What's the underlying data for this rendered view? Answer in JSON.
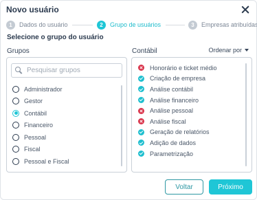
{
  "dialog": {
    "title": "Novo usuário",
    "close_icon": "close-icon"
  },
  "stepper": {
    "steps": [
      {
        "number": "1",
        "label": "Dados do usuário",
        "active": false
      },
      {
        "number": "2",
        "label": "Grupo de usuários",
        "active": true
      },
      {
        "number": "3",
        "label": "Empresas atribuídas",
        "active": false
      }
    ]
  },
  "section_title": "Selecione o grupo do usuário",
  "groups": {
    "label": "Grupos",
    "search": {
      "placeholder": "Pesquisar grupos",
      "value": "",
      "icon": "search-icon"
    },
    "items": [
      {
        "label": "Administrador",
        "selected": false
      },
      {
        "label": "Gestor",
        "selected": false
      },
      {
        "label": "Contábil",
        "selected": true
      },
      {
        "label": "Financeiro",
        "selected": false
      },
      {
        "label": "Pessoal",
        "selected": false
      },
      {
        "label": "Fiscal",
        "selected": false
      },
      {
        "label": "Pessoal e Fiscal",
        "selected": false
      }
    ]
  },
  "permissions": {
    "label": "Contábil",
    "order_by": "Ordenar por",
    "items": [
      {
        "label": "Honorário e ticket médio",
        "allowed": false
      },
      {
        "label": "Criação de empresa",
        "allowed": true
      },
      {
        "label": "Análise contábil",
        "allowed": true
      },
      {
        "label": "Análise financeiro",
        "allowed": true
      },
      {
        "label": "Análise pessoal",
        "allowed": false
      },
      {
        "label": "Análise fiscal",
        "allowed": false
      },
      {
        "label": "Geração de relatórios",
        "allowed": true
      },
      {
        "label": "Adição de dados",
        "allowed": true
      },
      {
        "label": "Parametrização",
        "allowed": true
      }
    ]
  },
  "buttons": {
    "back": "Voltar",
    "next": "Próximo"
  },
  "colors": {
    "accent": "#1fc6d6",
    "allowed": "#1fbfcf",
    "denied": "#d9344b",
    "text": "#2b3a4e"
  }
}
